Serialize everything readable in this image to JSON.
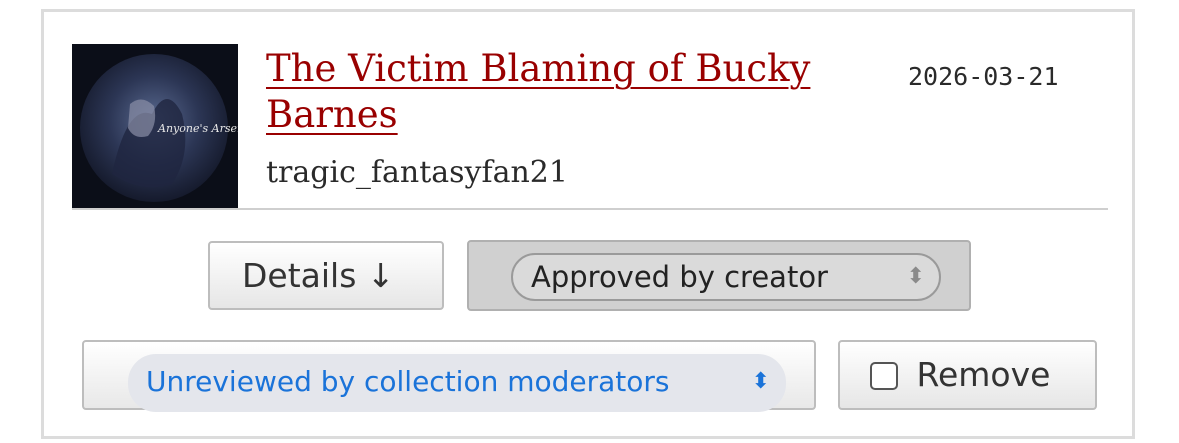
{
  "work": {
    "title": "The Victim Blaming of Bucky Barnes",
    "author": "tragic_fantasyfan21",
    "date": "2026-03-21",
    "avatar_text": "Anyone's Arsenal"
  },
  "actions": {
    "details_label": "Details ↓",
    "creator_status": "Approved by creator",
    "moderator_status": "Unreviewed by collection moderators",
    "remove_label": "Remove"
  },
  "icons": {
    "select_chevron": "⬍",
    "details_arrow": "down-arrow-icon"
  },
  "colors": {
    "title_link": "#990000",
    "select_text_blue": "#1a73d9",
    "approved_bg": "#d0d0d0"
  }
}
